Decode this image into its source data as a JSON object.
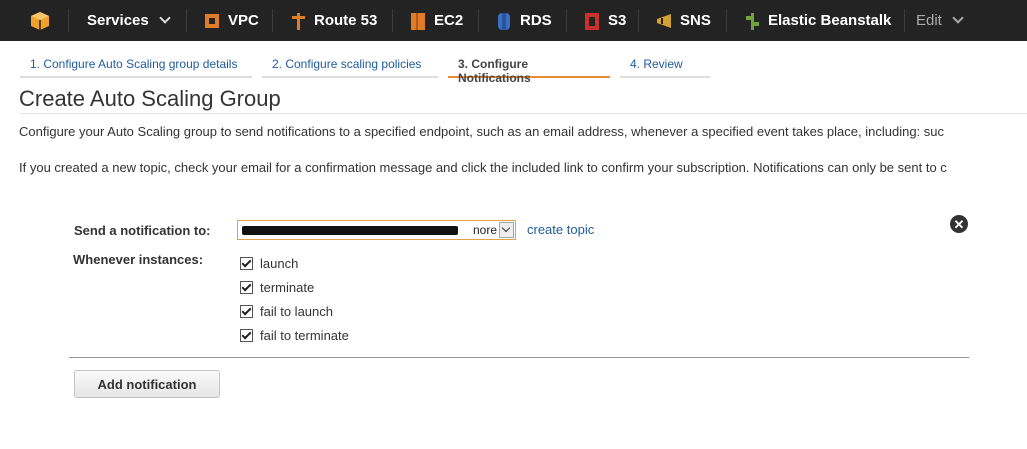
{
  "topbar": {
    "services_label": "Services",
    "items": [
      {
        "label": "VPC",
        "icon": "vpc-icon",
        "color": "#e07b28"
      },
      {
        "label": "Route 53",
        "icon": "route53-icon",
        "color": "#e07b28"
      },
      {
        "label": "EC2",
        "icon": "ec2-icon",
        "color": "#e07b28"
      },
      {
        "label": "RDS",
        "icon": "rds-icon",
        "color": "#3b6fc4"
      },
      {
        "label": "S3",
        "icon": "s3-icon",
        "color": "#c8322a"
      },
      {
        "label": "SNS",
        "icon": "sns-icon",
        "color": "#d2a233"
      },
      {
        "label": "Elastic Beanstalk",
        "icon": "beanstalk-icon",
        "color": "#6ea43a"
      }
    ],
    "edit_label": "Edit"
  },
  "steps": [
    {
      "label": "1. Configure Auto Scaling group details",
      "active": false
    },
    {
      "label": "2. Configure scaling policies",
      "active": false
    },
    {
      "label": "3. Configure Notifications",
      "active": true
    },
    {
      "label": "4. Review",
      "active": false
    }
  ],
  "page": {
    "title": "Create Auto Scaling Group",
    "desc1": "Configure your Auto Scaling group to send notifications to a specified endpoint, such as an email address, whenever a specified event takes place, including: suc",
    "desc2": "If you created a new topic, check your email for a confirmation message and click the included link to confirm your subscription. Notifications can only be sent to c"
  },
  "notification": {
    "send_label": "Send a notification to:",
    "topic_tail": "nore",
    "create_topic": "create topic",
    "whenever_label": "Whenever instances:",
    "events": [
      {
        "label": "launch",
        "checked": true
      },
      {
        "label": "terminate",
        "checked": true
      },
      {
        "label": "fail to launch",
        "checked": true
      },
      {
        "label": "fail to terminate",
        "checked": true
      }
    ],
    "close_glyph": "✕"
  },
  "actions": {
    "add_notification": "Add notification"
  },
  "colors": {
    "accent": "#e98b32",
    "link": "#1f5c9b",
    "topbar": "#232323"
  }
}
